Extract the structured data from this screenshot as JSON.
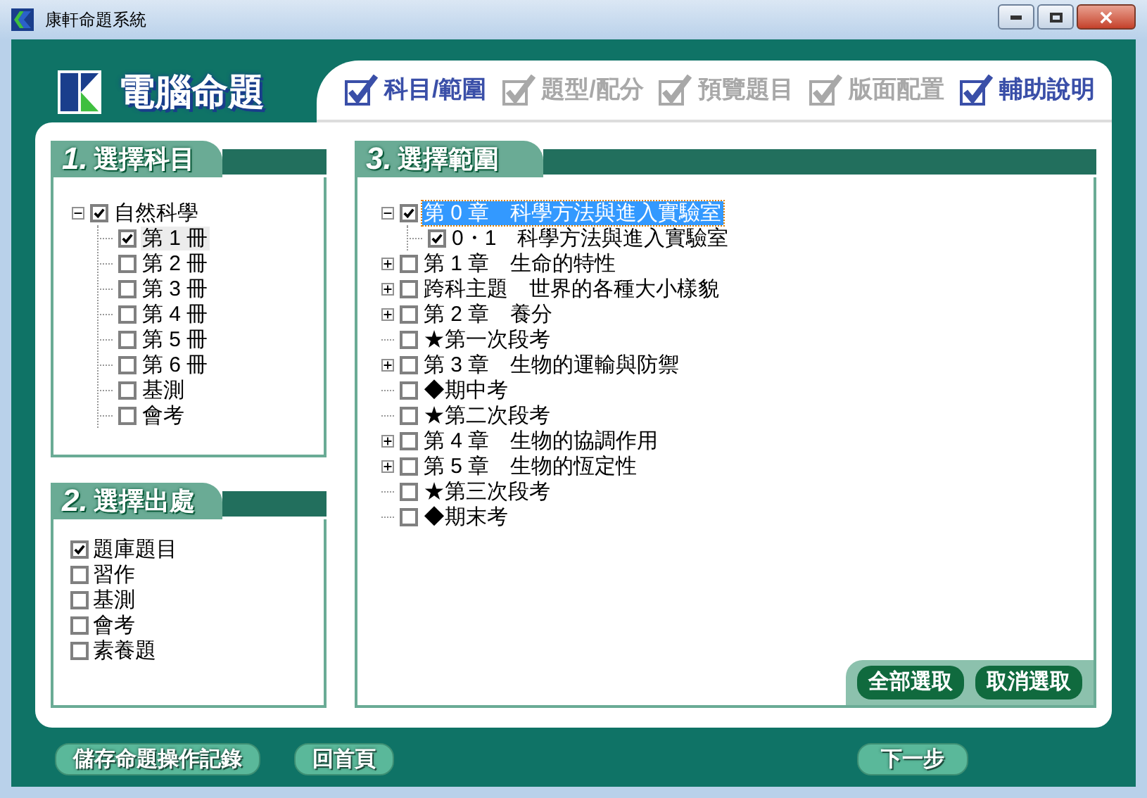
{
  "window": {
    "title": "康軒命題系統"
  },
  "app_title": "電腦命題",
  "steps": [
    {
      "label": "科目/範圍",
      "active": true
    },
    {
      "label": "題型/配分",
      "active": false
    },
    {
      "label": "預覽題目",
      "active": false
    },
    {
      "label": "版面配置",
      "active": false
    },
    {
      "label": "輔助說明",
      "active": true
    }
  ],
  "subject_panel": {
    "number": "1.",
    "title": "選擇科目",
    "tree": [
      {
        "label": "自然科學",
        "kind": "group",
        "expanded": true,
        "checked": true,
        "selected": false,
        "children": [
          {
            "label": "第 1 冊",
            "kind": "leaf",
            "checked": true,
            "selected": true
          },
          {
            "label": "第 2 冊",
            "kind": "leaf",
            "checked": false,
            "selected": false
          },
          {
            "label": "第 3 冊",
            "kind": "leaf",
            "checked": false,
            "selected": false
          },
          {
            "label": "第 4 冊",
            "kind": "leaf",
            "checked": false,
            "selected": false
          },
          {
            "label": "第 5 冊",
            "kind": "leaf",
            "checked": false,
            "selected": false
          },
          {
            "label": "第 6 冊",
            "kind": "leaf",
            "checked": false,
            "selected": false
          },
          {
            "label": "基測",
            "kind": "leaf",
            "checked": false,
            "selected": false
          },
          {
            "label": "會考",
            "kind": "leaf",
            "checked": false,
            "selected": false
          }
        ]
      }
    ]
  },
  "source_panel": {
    "number": "2.",
    "title": "選擇出處",
    "items": [
      {
        "label": "題庫題目",
        "checked": true
      },
      {
        "label": "習作",
        "checked": false
      },
      {
        "label": "基測",
        "checked": false
      },
      {
        "label": "會考",
        "checked": false
      },
      {
        "label": "素養題",
        "checked": false
      }
    ]
  },
  "range_panel": {
    "number": "3.",
    "title": "選擇範圍",
    "tree": [
      {
        "label": "第 0 章　科學方法與進入實驗室",
        "kind": "group",
        "expanded": true,
        "checked": true,
        "selected": true,
        "children": [
          {
            "label": "0・1　科學方法與進入實驗室",
            "kind": "leaf",
            "checked": true,
            "selected": false
          }
        ]
      },
      {
        "label": "第 1 章　生命的特性",
        "kind": "group",
        "expanded": false,
        "checked": false,
        "selected": false
      },
      {
        "label": "跨科主題　世界的各種大小樣貌",
        "kind": "group",
        "expanded": false,
        "checked": false,
        "selected": false
      },
      {
        "label": "第 2 章　養分",
        "kind": "group",
        "expanded": false,
        "checked": false,
        "selected": false
      },
      {
        "label": "★第一次段考",
        "kind": "leaf",
        "checked": false,
        "selected": false
      },
      {
        "label": "第 3 章　生物的運輸與防禦",
        "kind": "group",
        "expanded": false,
        "checked": false,
        "selected": false
      },
      {
        "label": "◆期中考",
        "kind": "leaf",
        "checked": false,
        "selected": false
      },
      {
        "label": "★第二次段考",
        "kind": "leaf",
        "checked": false,
        "selected": false
      },
      {
        "label": "第 4 章　生物的協調作用",
        "kind": "group",
        "expanded": false,
        "checked": false,
        "selected": false
      },
      {
        "label": "第 5 章　生物的恆定性",
        "kind": "group",
        "expanded": false,
        "checked": false,
        "selected": false
      },
      {
        "label": "★第三次段考",
        "kind": "leaf",
        "checked": false,
        "selected": false
      },
      {
        "label": "◆期末考",
        "kind": "leaf",
        "checked": false,
        "selected": false
      }
    ],
    "buttons": [
      "全部選取",
      "取消選取"
    ]
  },
  "footer_buttons": [
    "儲存命題操作記錄",
    "回首頁",
    "下一步"
  ]
}
